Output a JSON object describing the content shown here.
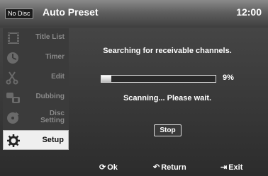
{
  "header": {
    "disc_badge": "No Disc",
    "title": "Auto Preset",
    "clock": "12:00"
  },
  "sidebar": {
    "items": [
      {
        "label": "Title List",
        "icon": "film-icon"
      },
      {
        "label": "Timer",
        "icon": "clock-icon"
      },
      {
        "label": "Edit",
        "icon": "scissors-icon"
      },
      {
        "label": "Dubbing",
        "icon": "dubbing-icon"
      },
      {
        "label": "Disc Setting",
        "icon": "disc-icon"
      },
      {
        "label": "Setup",
        "icon": "gear-icon",
        "active": true
      }
    ]
  },
  "main": {
    "message": "Searching for receivable channels.",
    "progress_percent": 9,
    "progress_label": "9%",
    "status": "Scanning... Please wait.",
    "stop_label": "Stop"
  },
  "footer": {
    "ok_label": "Ok",
    "return_label": "Return",
    "exit_label": "Exit"
  },
  "colors": {
    "header_top": "#8a8a8a",
    "background": "#3a3a3a",
    "active_item": "#efefef"
  }
}
